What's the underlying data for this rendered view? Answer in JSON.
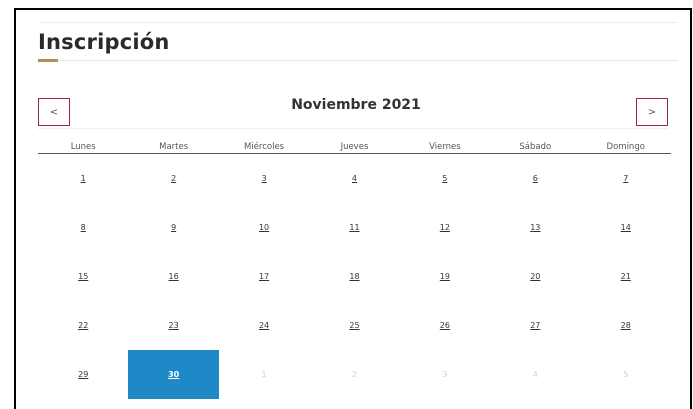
{
  "page": {
    "title": "Inscripción"
  },
  "calendar": {
    "prev_label": "<",
    "next_label": ">",
    "month_label": "Noviembre 2021",
    "weekdays": [
      "Lunes",
      "Martes",
      "Miércoles",
      "Jueves",
      "Viernes",
      "Sábado",
      "Domingo"
    ],
    "weeks": [
      [
        "1",
        "2",
        "3",
        "4",
        "5",
        "6",
        "7"
      ],
      [
        "8",
        "9",
        "10",
        "11",
        "12",
        "13",
        "14"
      ],
      [
        "15",
        "16",
        "17",
        "18",
        "19",
        "20",
        "21"
      ],
      [
        "22",
        "23",
        "24",
        "25",
        "26",
        "27",
        "28"
      ],
      [
        "29",
        "30",
        "1",
        "2",
        "3",
        "4",
        "5"
      ]
    ],
    "selected_day": "30",
    "next_month_days": [
      "1",
      "2",
      "3",
      "4",
      "5"
    ]
  },
  "colors": {
    "accent": "#b38e5d",
    "nav_border": "#9d2449",
    "selected": "#1f89c8"
  }
}
